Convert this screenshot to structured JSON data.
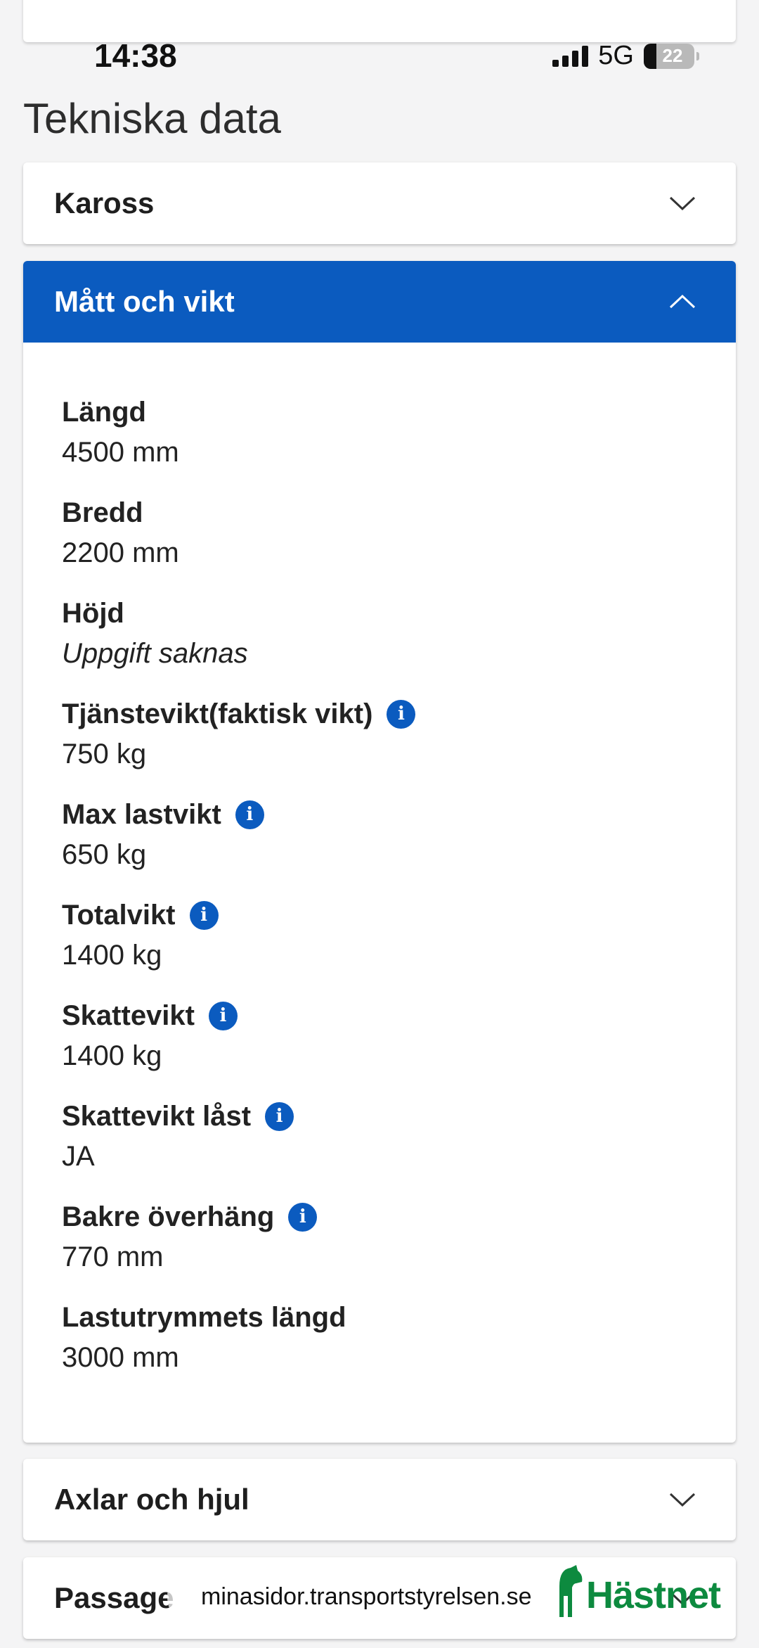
{
  "status_bar": {
    "time": "14:38",
    "network": "5G",
    "battery": "22"
  },
  "section_title": "Tekniska data",
  "accordions": {
    "kaross": {
      "label": "Kaross",
      "expanded": false
    },
    "matt_och_vikt": {
      "label": "Mått och vikt",
      "expanded": true
    },
    "axlar": {
      "label": "Axlar och hjul",
      "expanded": false
    },
    "passagerare": {
      "label": "Passage",
      "expanded": false
    }
  },
  "fields": [
    {
      "name": "Längd",
      "value": "4500 mm",
      "info": false
    },
    {
      "name": "Bredd",
      "value": "2200 mm",
      "info": false
    },
    {
      "name": "Höjd",
      "value": "Uppgift saknas",
      "info": false,
      "missing": true
    },
    {
      "name": "Tjänstevikt(faktisk vikt)",
      "value": "750 kg",
      "info": true
    },
    {
      "name": "Max lastvikt",
      "value": "650 kg",
      "info": true
    },
    {
      "name": "Totalvikt",
      "value": "1400 kg",
      "info": true
    },
    {
      "name": "Skattevikt",
      "value": "1400 kg",
      "info": true
    },
    {
      "name": "Skattevikt låst",
      "value": "JA",
      "info": true
    },
    {
      "name": "Bakre överhäng",
      "value": "770 mm",
      "info": true
    },
    {
      "name": "Lastutrymmets längd",
      "value": "3000 mm",
      "info": false
    }
  ],
  "url": "minasidor.transportstyrelsen.se",
  "brand": "Hästnet",
  "colors": {
    "accent": "#0b5bbf",
    "brand_green": "#0d8a3f"
  }
}
